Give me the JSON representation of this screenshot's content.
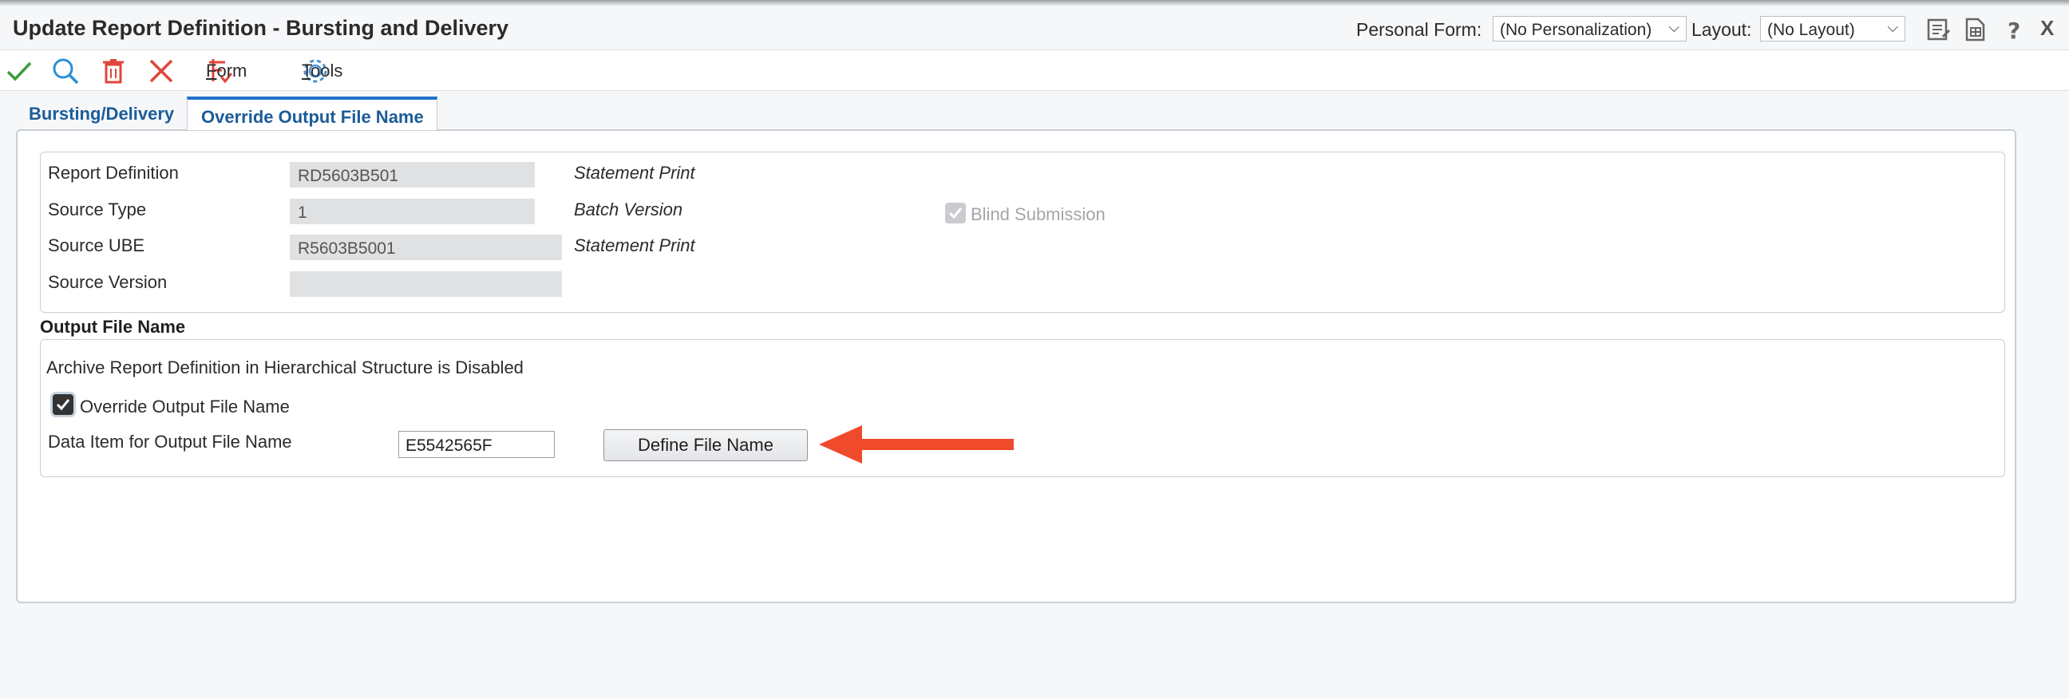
{
  "window": {
    "title": "Update Report Definition - Bursting and Delivery",
    "personal_form_label": "Personal Form:",
    "personal_form_value": "(No Personalization)",
    "layout_label": "Layout:",
    "layout_value": "(No Layout)",
    "close_label": "X"
  },
  "toolbar": {
    "form_label": "Form",
    "tools_label": "Tools"
  },
  "tabs": [
    {
      "label": "Bursting/Delivery"
    },
    {
      "label": "Override Output File Name"
    }
  ],
  "report": {
    "report_definition_label": "Report Definition",
    "report_definition_value": "RD5603B501",
    "report_definition_desc": "Statement Print",
    "source_type_label": "Source Type",
    "source_type_value": "1",
    "source_type_desc": "Batch Version",
    "source_ube_label": "Source UBE",
    "source_ube_value": "R5603B5001",
    "source_ube_desc": "Statement Print",
    "source_version_label": "Source Version",
    "source_version_value": "",
    "blind_submission_label": "Blind Submission"
  },
  "output": {
    "section_title": "Output File Name",
    "archive_note": "Archive Report Definition in Hierarchical Structure is Disabled",
    "override_label": "Override Output File Name",
    "data_item_label": "Data Item for Output File Name",
    "data_item_value": "E5542565F",
    "define_button_label": "Define File Name"
  },
  "colors": {
    "accent": "#1f72c6",
    "tab_text": "#1c5c99",
    "arrow": "#f04a2c"
  }
}
